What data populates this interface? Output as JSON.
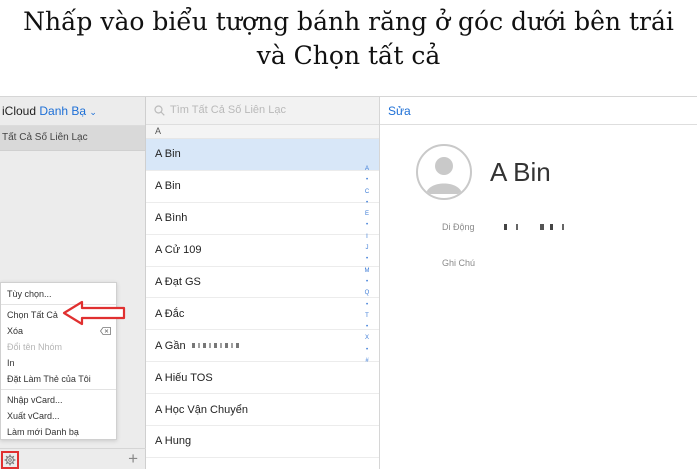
{
  "caption": {
    "line1": "Nhấp vào biểu tượng bánh răng ở góc dưới bên trái",
    "line2": "và Chọn tất cả"
  },
  "sidebar": {
    "app_name": "iCloud",
    "section_title": "Danh Bạ",
    "chevron": "⌄",
    "all_contacts": "Tất Cả Số Liên Lạc",
    "add_icon": "+"
  },
  "menu": {
    "items": [
      "Tùy chọn...",
      "Chọn Tất Cả",
      "Xóa",
      "Đổi tên Nhóm",
      "In",
      "Đặt Làm Thẻ của Tôi",
      "Nhập vCard...",
      "Xuất vCard...",
      "Làm mới Danh bạ"
    ]
  },
  "list": {
    "search_placeholder": "Tìm Tất Cả Số Liên Lạc",
    "section_letter": "A",
    "contacts": [
      "A Bin",
      "A Bin",
      "A Bình",
      "A Cử 109",
      "A Đạt GS",
      "A Đắc",
      "A Gần",
      "A Hiếu TOS",
      "A Học Vận Chuyển",
      "A Hung"
    ],
    "index": [
      "A",
      "•",
      "C",
      "•",
      "E",
      "•",
      "I",
      "J",
      "•",
      "M",
      "•",
      "Q",
      "•",
      "T",
      "•",
      "X",
      "•",
      "#"
    ]
  },
  "detail": {
    "edit_label": "Sửa",
    "contact_name": "A Bin",
    "mobile_label": "Di Động",
    "note_label": "Ghi Chú"
  },
  "colors": {
    "accent": "#1d6fd6",
    "highlight": "#e03030",
    "selected_row": "#d8e7f8"
  }
}
